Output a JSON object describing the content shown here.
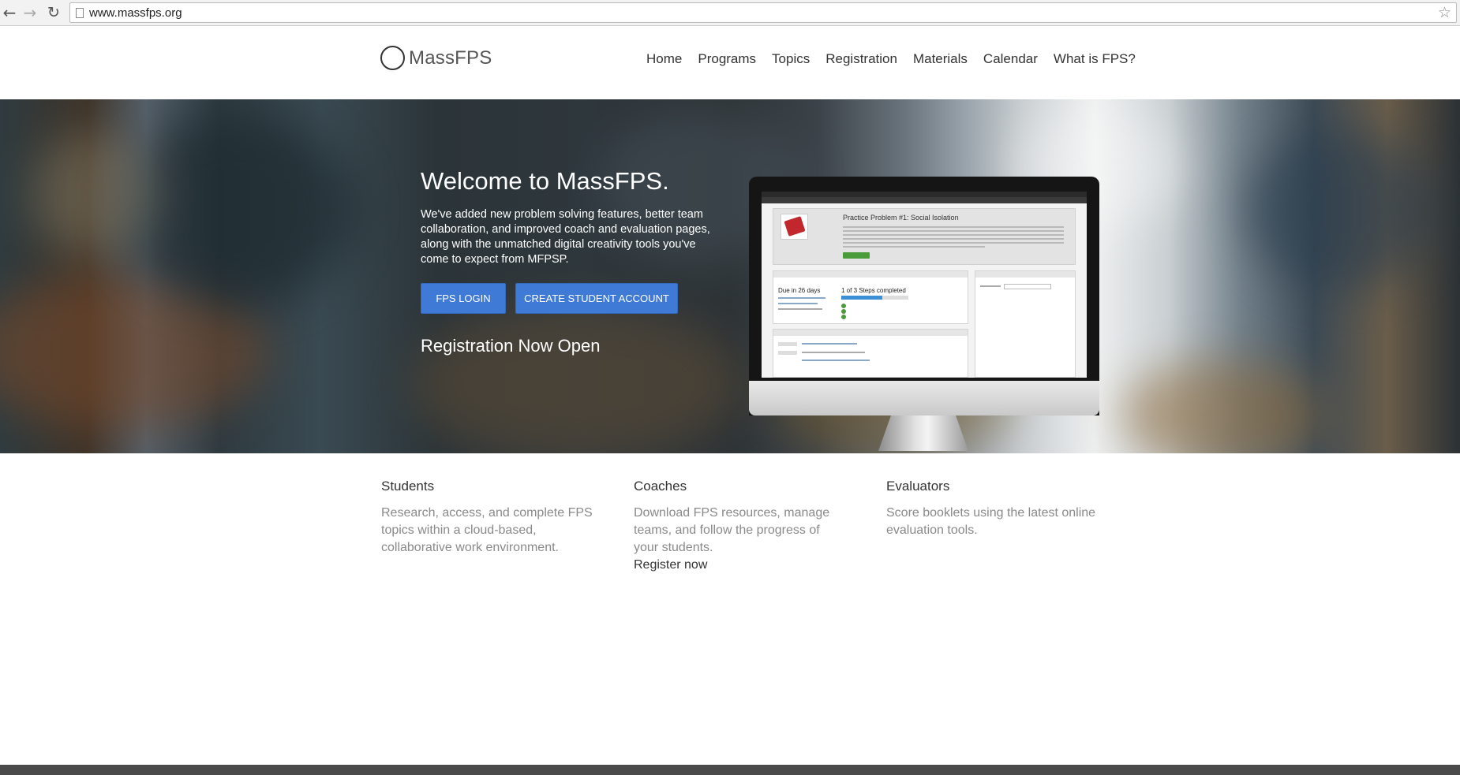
{
  "browser": {
    "url": "www.massfps.org"
  },
  "site": {
    "logo_text": "MassFPS",
    "nav": [
      "Home",
      "Programs",
      "Topics",
      "Registration",
      "Materials",
      "Calendar",
      "What is FPS?"
    ]
  },
  "hero": {
    "title": "Welcome to MassFPS.",
    "description": "We've added new problem solving features, better team collaboration, and improved coach and evaluation pages, along with the unmatched digital creativity tools you've come to expect from MFPSP.",
    "login_button": "FPS LOGIN",
    "create_button": "CREATE STUDENT ACCOUNT",
    "registration_text": "Registration Now Open",
    "screen": {
      "problem_title": "Practice Problem #1: Social Isolation",
      "due": "Due in 26 days",
      "steps": "1 of 3 Steps completed"
    }
  },
  "features": [
    {
      "title": "Students",
      "text": "Research, access, and complete FPS topics within a cloud-based, collaborative work environment."
    },
    {
      "title": "Coaches",
      "text": "Download FPS resources, manage teams, and follow the progress of your students.",
      "link": "Register now"
    },
    {
      "title": "Evaluators",
      "text": "Score booklets using the latest online evaluation tools."
    }
  ],
  "colors": {
    "button_blue": "#3f7ad6",
    "footer": "#4a4a4a"
  }
}
